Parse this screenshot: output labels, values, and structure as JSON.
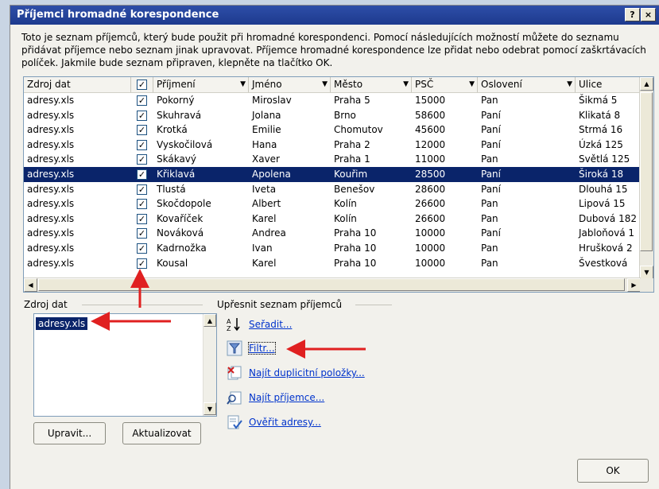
{
  "dialog": {
    "title": "Příjemci hromadné korespondence",
    "help_btn": "?",
    "close_btn": "×",
    "description": "Toto je seznam příjemců, který bude použit při hromadné korespondenci. Pomocí následujících možností můžete do seznamu přidávat příjemce nebo seznam jinak upravovat. Příjemce hromadné korespondence lze přidat nebo odebrat pomocí zaškrtávacích políček. Jakmile bude seznam připraven, klepněte na tlačítko OK."
  },
  "grid": {
    "columns": [
      "Zdroj dat",
      "✓",
      "Příjmení",
      "Jméno",
      "Město",
      "PSČ",
      "Oslovení",
      "Ulice"
    ],
    "rows": [
      {
        "src": "adresy.xls",
        "chk": "✓",
        "prijmeni": "Pokorný",
        "jmeno": "Miroslav",
        "mesto": "Praha 5",
        "psc": "15000",
        "osloveni": "Pan",
        "ulice": "Šikmá 5"
      },
      {
        "src": "adresy.xls",
        "chk": "✓",
        "prijmeni": "Skuhravá",
        "jmeno": "Jolana",
        "mesto": "Brno",
        "psc": "58600",
        "osloveni": "Paní",
        "ulice": "Klikatá 8"
      },
      {
        "src": "adresy.xls",
        "chk": "✓",
        "prijmeni": "Krotká",
        "jmeno": "Emilie",
        "mesto": "Chomutov",
        "psc": "45600",
        "osloveni": "Paní",
        "ulice": "Strmá 16"
      },
      {
        "src": "adresy.xls",
        "chk": "✓",
        "prijmeni": "Vyskočilová",
        "jmeno": "Hana",
        "mesto": "Praha 2",
        "psc": "12000",
        "osloveni": "Paní",
        "ulice": "Úzká 125"
      },
      {
        "src": "adresy.xls",
        "chk": "✓",
        "prijmeni": "Skákavý",
        "jmeno": "Xaver",
        "mesto": "Praha 1",
        "psc": "11000",
        "osloveni": "Pan",
        "ulice": "Světlá 125"
      },
      {
        "src": "adresy.xls",
        "chk": "✓",
        "prijmeni": "Křiklavá",
        "jmeno": "Apolena",
        "mesto": "Kouřim",
        "psc": "28500",
        "osloveni": "Paní",
        "ulice": "Široká 18",
        "selected": true
      },
      {
        "src": "adresy.xls",
        "chk": "✓",
        "prijmeni": "Tlustá",
        "jmeno": "Iveta",
        "mesto": "Benešov",
        "psc": "28600",
        "osloveni": "Paní",
        "ulice": "Dlouhá 15"
      },
      {
        "src": "adresy.xls",
        "chk": "✓",
        "prijmeni": "Skočdopole",
        "jmeno": "Albert",
        "mesto": "Kolín",
        "psc": "26600",
        "osloveni": "Pan",
        "ulice": "Lipová 15"
      },
      {
        "src": "adresy.xls",
        "chk": "✓",
        "prijmeni": "Kovaříček",
        "jmeno": "Karel",
        "mesto": "Kolín",
        "psc": "26600",
        "osloveni": "Pan",
        "ulice": "Dubová 182"
      },
      {
        "src": "adresy.xls",
        "chk": "✓",
        "prijmeni": "Nováková",
        "jmeno": "Andrea",
        "mesto": "Praha 10",
        "psc": "10000",
        "osloveni": "Paní",
        "ulice": "Jabloňová 1"
      },
      {
        "src": "adresy.xls",
        "chk": "✓",
        "prijmeni": "Kadrnožka",
        "jmeno": "Ivan",
        "mesto": "Praha 10",
        "psc": "10000",
        "osloveni": "Pan",
        "ulice": "Hrušková 2"
      },
      {
        "src": "adresy.xls",
        "chk": "✓",
        "prijmeni": "Kousal",
        "jmeno": "Karel",
        "mesto": "Praha 10",
        "psc": "10000",
        "osloveni": "Pan",
        "ulice": "Švestková"
      }
    ]
  },
  "source": {
    "label": "Zdroj dat",
    "items": [
      "adresy.xls"
    ],
    "edit_btn": "Upravit...",
    "refresh_btn": "Aktualizovat"
  },
  "refine": {
    "label": "Upřesnit seznam příjemců",
    "links": [
      "Seřadit...",
      "Filtr...",
      "Najít duplicitní položky...",
      "Najít příjemce...",
      "Ověřit adresy..."
    ],
    "icons": [
      "sort-az-icon",
      "filter-icon",
      "find-duplicates-icon",
      "find-recipient-icon",
      "validate-address-icon"
    ]
  },
  "ok_btn": "OK",
  "colors": {
    "accent": "#0a246a",
    "arrow": "#e02020",
    "link": "#0033cc"
  }
}
